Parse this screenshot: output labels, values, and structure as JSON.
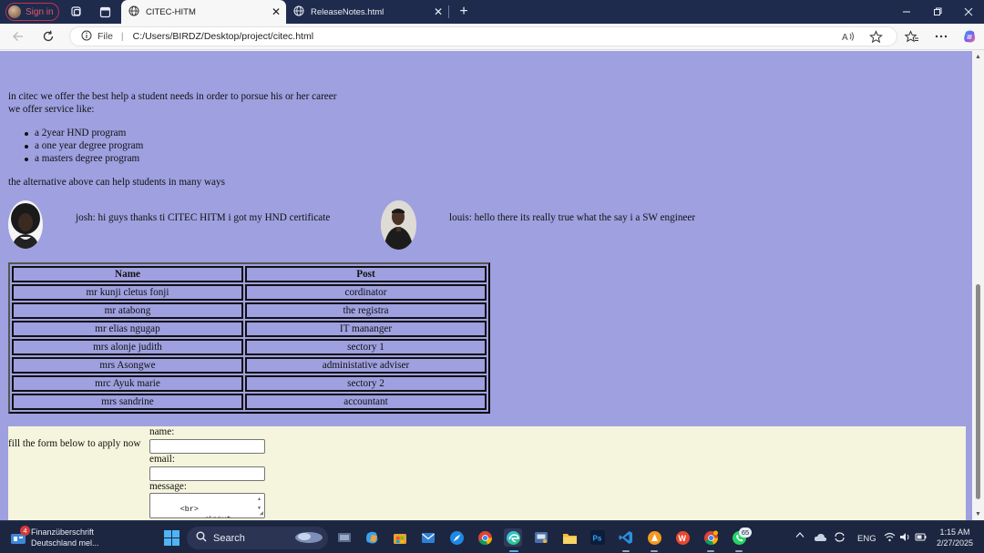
{
  "browser": {
    "profile_label": "Sign in",
    "tabs": [
      {
        "title": "CITEC-HITM",
        "active": true
      },
      {
        "title": "ReleaseNotes.html",
        "active": false
      }
    ],
    "address": {
      "scheme_label": "File",
      "url": "C:/Users/BIRDZ/Desktop/project/citec.html"
    }
  },
  "page": {
    "intro_line1": "in citec we offer the best help a student needs in order to porsue his or her career",
    "intro_line2": "we offer service like:",
    "programs": [
      "a 2year HND program",
      "a one year degree program",
      "a masters degree program"
    ],
    "closing": "the alternative above can help students in many ways",
    "testimonials": [
      {
        "text": "josh: hi guys thanks ti CITEC HITM i got my HND certificate"
      },
      {
        "text": "louis: hello there its really true what the say i a SW engineer"
      }
    ],
    "staff_table": {
      "headers": [
        "Name",
        "Post"
      ],
      "rows": [
        [
          "mr kunji cletus fonji",
          "cordinator"
        ],
        [
          "mr atabong",
          "the registra"
        ],
        [
          "mr elias ngugap",
          "IT mananger"
        ],
        [
          "mrs alonje judith",
          "sectory 1"
        ],
        [
          "mrs Asongwe",
          "administative adviser"
        ],
        [
          "mrc Ayuk marie",
          "sectory 2"
        ],
        [
          "mrs sandrine",
          "accountant"
        ]
      ]
    },
    "form": {
      "lead": "fill the form below to apply now",
      "name_label": "name:",
      "email_label": "email:",
      "message_label": "message:",
      "message_value": "<br>\n           <input"
    }
  },
  "taskbar": {
    "news_title": "Finanzüberschrift",
    "news_subtitle": "Deutschland mel...",
    "news_badge": "4",
    "search_label": "Search",
    "whatsapp_badge": "65",
    "language": "ENG",
    "time": "1:15 AM",
    "date": "2/27/2025"
  },
  "colors": {
    "page_background": "#9fa0e0",
    "form_background": "#f5f5dd",
    "titlebar": "#1f2b4d",
    "taskbar": "#1d2640"
  }
}
